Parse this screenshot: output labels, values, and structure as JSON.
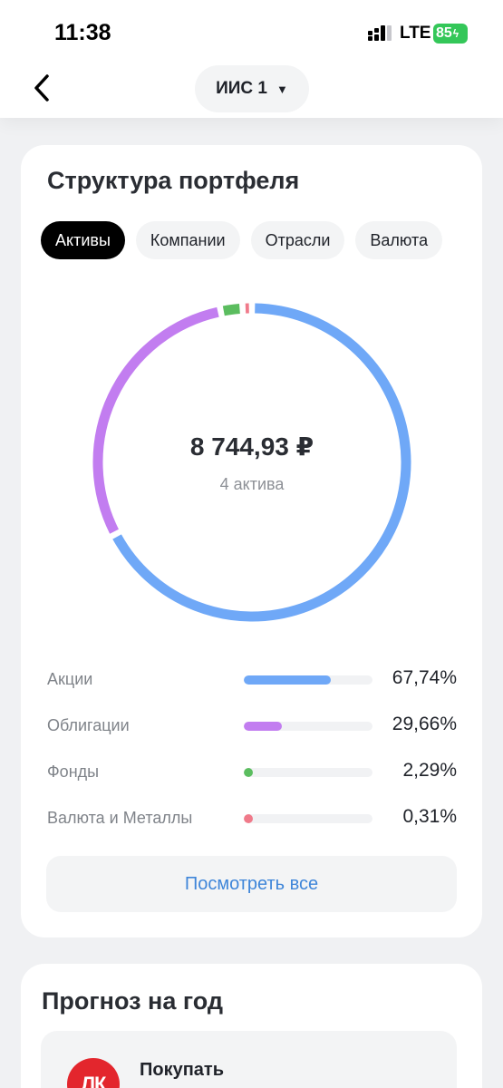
{
  "status_bar": {
    "time": "11:38",
    "network": "LTE",
    "battery": "85"
  },
  "header": {
    "account": "ИИС 1"
  },
  "portfolio": {
    "title": "Структура портфеля",
    "tabs": [
      "Активы",
      "Компании",
      "Отрасли",
      "Валюта"
    ],
    "total": "8 744,93 ₽",
    "assets_count": "4 актива",
    "items": [
      {
        "label": "Акции",
        "percent": "67,74%",
        "value": 67.74,
        "color": "#6fa8f7"
      },
      {
        "label": "Облигации",
        "percent": "29,66%",
        "value": 29.66,
        "color": "#c27df0"
      },
      {
        "label": "Фонды",
        "percent": "2,29%",
        "value": 2.29,
        "color": "#5bbd5f"
      },
      {
        "label": "Валюта и Металлы",
        "percent": "0,31%",
        "value": 0.31,
        "color": "#f07a8a"
      }
    ],
    "see_all": "Посмотреть все"
  },
  "forecast": {
    "title": "Прогноз на год",
    "action": "Покупать",
    "logo_text": "ЛК"
  },
  "colors": {
    "accent_blue": "#3f86d9",
    "stocks": "#6fa8f7",
    "bonds": "#c27df0",
    "funds": "#5bbd5f",
    "currency": "#f07a8a"
  },
  "icons": {
    "back": "chevron-left-icon",
    "dropdown": "triangle-down-icon",
    "signal": "cellular-signal-icon",
    "battery": "battery-charging-icon"
  }
}
